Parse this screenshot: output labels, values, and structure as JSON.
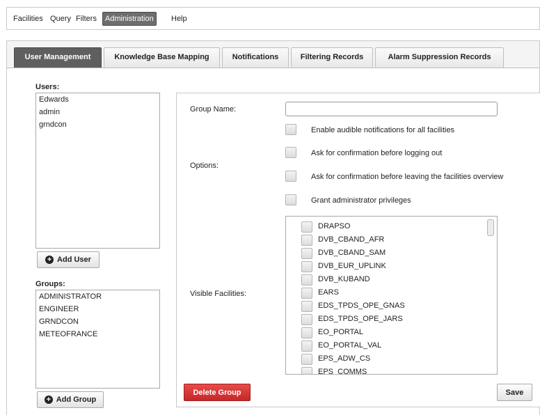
{
  "menubar": {
    "items": [
      {
        "label": "Facilities"
      },
      {
        "label": "Query"
      },
      {
        "label": "Filters"
      },
      {
        "label": "Administration",
        "active": true
      },
      {
        "label": "Help"
      }
    ]
  },
  "tabs": [
    {
      "label": "User Management",
      "active": true
    },
    {
      "label": "Knowledge Base Mapping"
    },
    {
      "label": "Notifications"
    },
    {
      "label": "Filtering Records"
    },
    {
      "label": "Alarm Suppression Records"
    }
  ],
  "users": {
    "title": "Users:",
    "items": [
      "Edwards",
      "admin",
      "grndcon"
    ],
    "add_label": "Add User"
  },
  "groups": {
    "title": "Groups:",
    "items": [
      "ADMINISTRATOR",
      "ENGINEER",
      "GRNDCON",
      "METEOFRANCE"
    ],
    "add_label": "Add Group"
  },
  "group_form": {
    "group_name_label": "Group Name:",
    "group_name_value": "",
    "options_label": "Options:",
    "options": [
      {
        "label": "Enable audible notifications for all facilities",
        "checked": false
      },
      {
        "label": "Ask for confirmation before logging out",
        "checked": false
      },
      {
        "label": "Ask for confirmation before leaving the facilities overview",
        "checked": false
      },
      {
        "label": "Grant administrator privileges",
        "checked": false
      }
    ],
    "visible_facilities_label": "Visible Facilities:",
    "facilities": [
      "DRAPSO",
      "DVB_CBAND_AFR",
      "DVB_CBAND_SAM",
      "DVB_EUR_UPLINK",
      "DVB_KUBAND",
      "EARS",
      "EDS_TPDS_OPE_GNAS",
      "EDS_TPDS_OPE_JARS",
      "EO_PORTAL",
      "EO_PORTAL_VAL",
      "EPS_ADW_CS",
      "EPS_COMMS"
    ],
    "delete_label": "Delete Group",
    "save_label": "Save"
  },
  "colors": {
    "active_tab": "#5f5f5f",
    "danger": "#d63333"
  }
}
